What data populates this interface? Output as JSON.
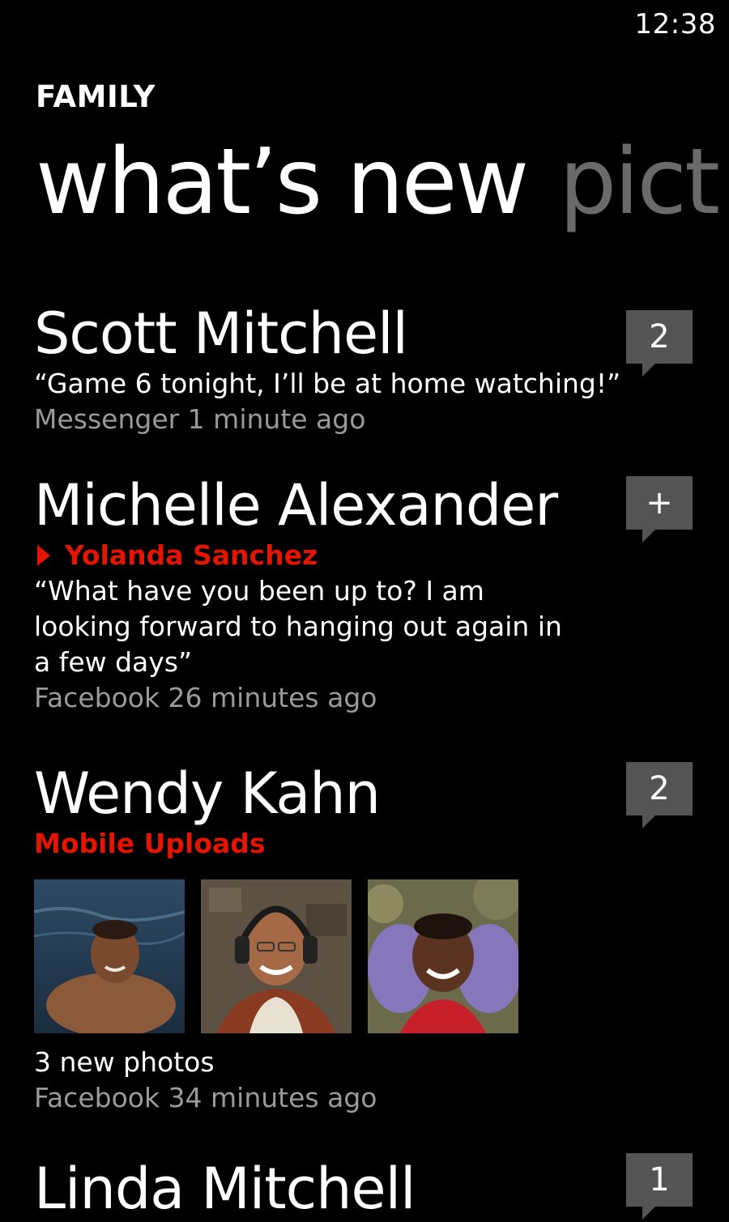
{
  "status_bar": {
    "time": "12:38"
  },
  "header": {
    "app_title": "FAMILY",
    "pivot_active": "what’s new",
    "pivot_next": "pict"
  },
  "feed": [
    {
      "name": "Scott Mitchell",
      "message": "“Game 6 tonight, I’ll be at home watching!”",
      "meta": "Messenger 1 minute ago",
      "badge": "2"
    },
    {
      "name": "Michelle Alexander",
      "to": "Yolanda Sanchez",
      "message": "“What have you been up to? I am looking forward to hanging out again in a few days”",
      "meta": "Facebook 26 minutes ago",
      "badge": "+"
    },
    {
      "name": "Wendy Kahn",
      "album": "Mobile Uploads",
      "photo_count_text": "3 new photos",
      "meta": "Facebook 34 minutes ago",
      "badge": "2"
    },
    {
      "name": "Linda Mitchell",
      "badge": "1"
    }
  ],
  "colors": {
    "accent": "#e51400",
    "badge_bg": "#545454",
    "meta_text": "#9a9a9a"
  }
}
